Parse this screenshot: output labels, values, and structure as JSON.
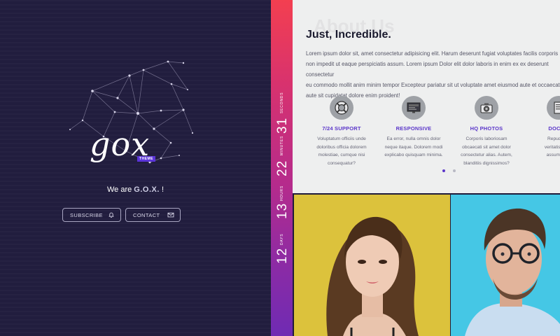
{
  "hero": {
    "logo_text": "gox",
    "logo_badge": "THEME",
    "tagline_prefix": "We are ",
    "tagline_brand": "G.O.X.",
    "tagline_suffix": " !",
    "subscribe_label": "SUBSCRIBE",
    "contact_label": "CONTACT",
    "subscribe_icon": "bell-icon",
    "contact_icon": "envelope-icon"
  },
  "countdown": [
    {
      "value": "31",
      "unit": "SECONDS"
    },
    {
      "value": "22",
      "unit": "MINUTES"
    },
    {
      "value": "13",
      "unit": "HOURS"
    },
    {
      "value": "12",
      "unit": "DAYS"
    }
  ],
  "about": {
    "ghost_title": "About Us",
    "heading": "Just, Incredible.",
    "paragraph_lines": [
      "Lorem ipsum dolor sit, amet consectetur adipisicing elit. Harum deserunt fugiat voluptates facilis corporis",
      "non impedit ut eaque perspiciatis assum. Lorem ipsum Dolor elit dolor laboris in enim ex ex deserunt consectetur",
      "eu commodo mollit anim minim tempor Excepteur pariatur sit ut voluptate amet eiusmod aute et occaecat",
      "aute sit cupidatat dolore enim proident!"
    ],
    "features": [
      {
        "icon": "lifebuoy-icon",
        "title": "7/24 SUPPORT",
        "lines": [
          "Voluptatum officiis unde",
          "doloribus officia dolorem",
          "molestiae, cumque nisi",
          "consequatur?"
        ]
      },
      {
        "icon": "monitor-icon",
        "title": "RESPONSIVE",
        "lines": [
          "Ea error, nulla omnis dolor",
          "neque itaque. Dolorem modi",
          "explicabo quisquam minima."
        ]
      },
      {
        "icon": "camera-icon",
        "title": "HQ PHOTOS",
        "lines": [
          "Corporis laboriosam",
          "obcaecati sit amet dolor",
          "consectetur alias. Autem,",
          "blanditiis dignissimos?"
        ]
      },
      {
        "icon": "document-icon",
        "title": "DOCUM",
        "lines": [
          "Repudiand",
          "veritatis culpa",
          "assumEnda"
        ]
      }
    ]
  },
  "colors": {
    "accent": "#5a35c9",
    "hero_bg": "#211d3e",
    "strip_top": "#f33f50",
    "strip_bottom": "#6f2bb3",
    "photo1_bg": "#dcc23c",
    "photo2_bg": "#45c7e5"
  }
}
